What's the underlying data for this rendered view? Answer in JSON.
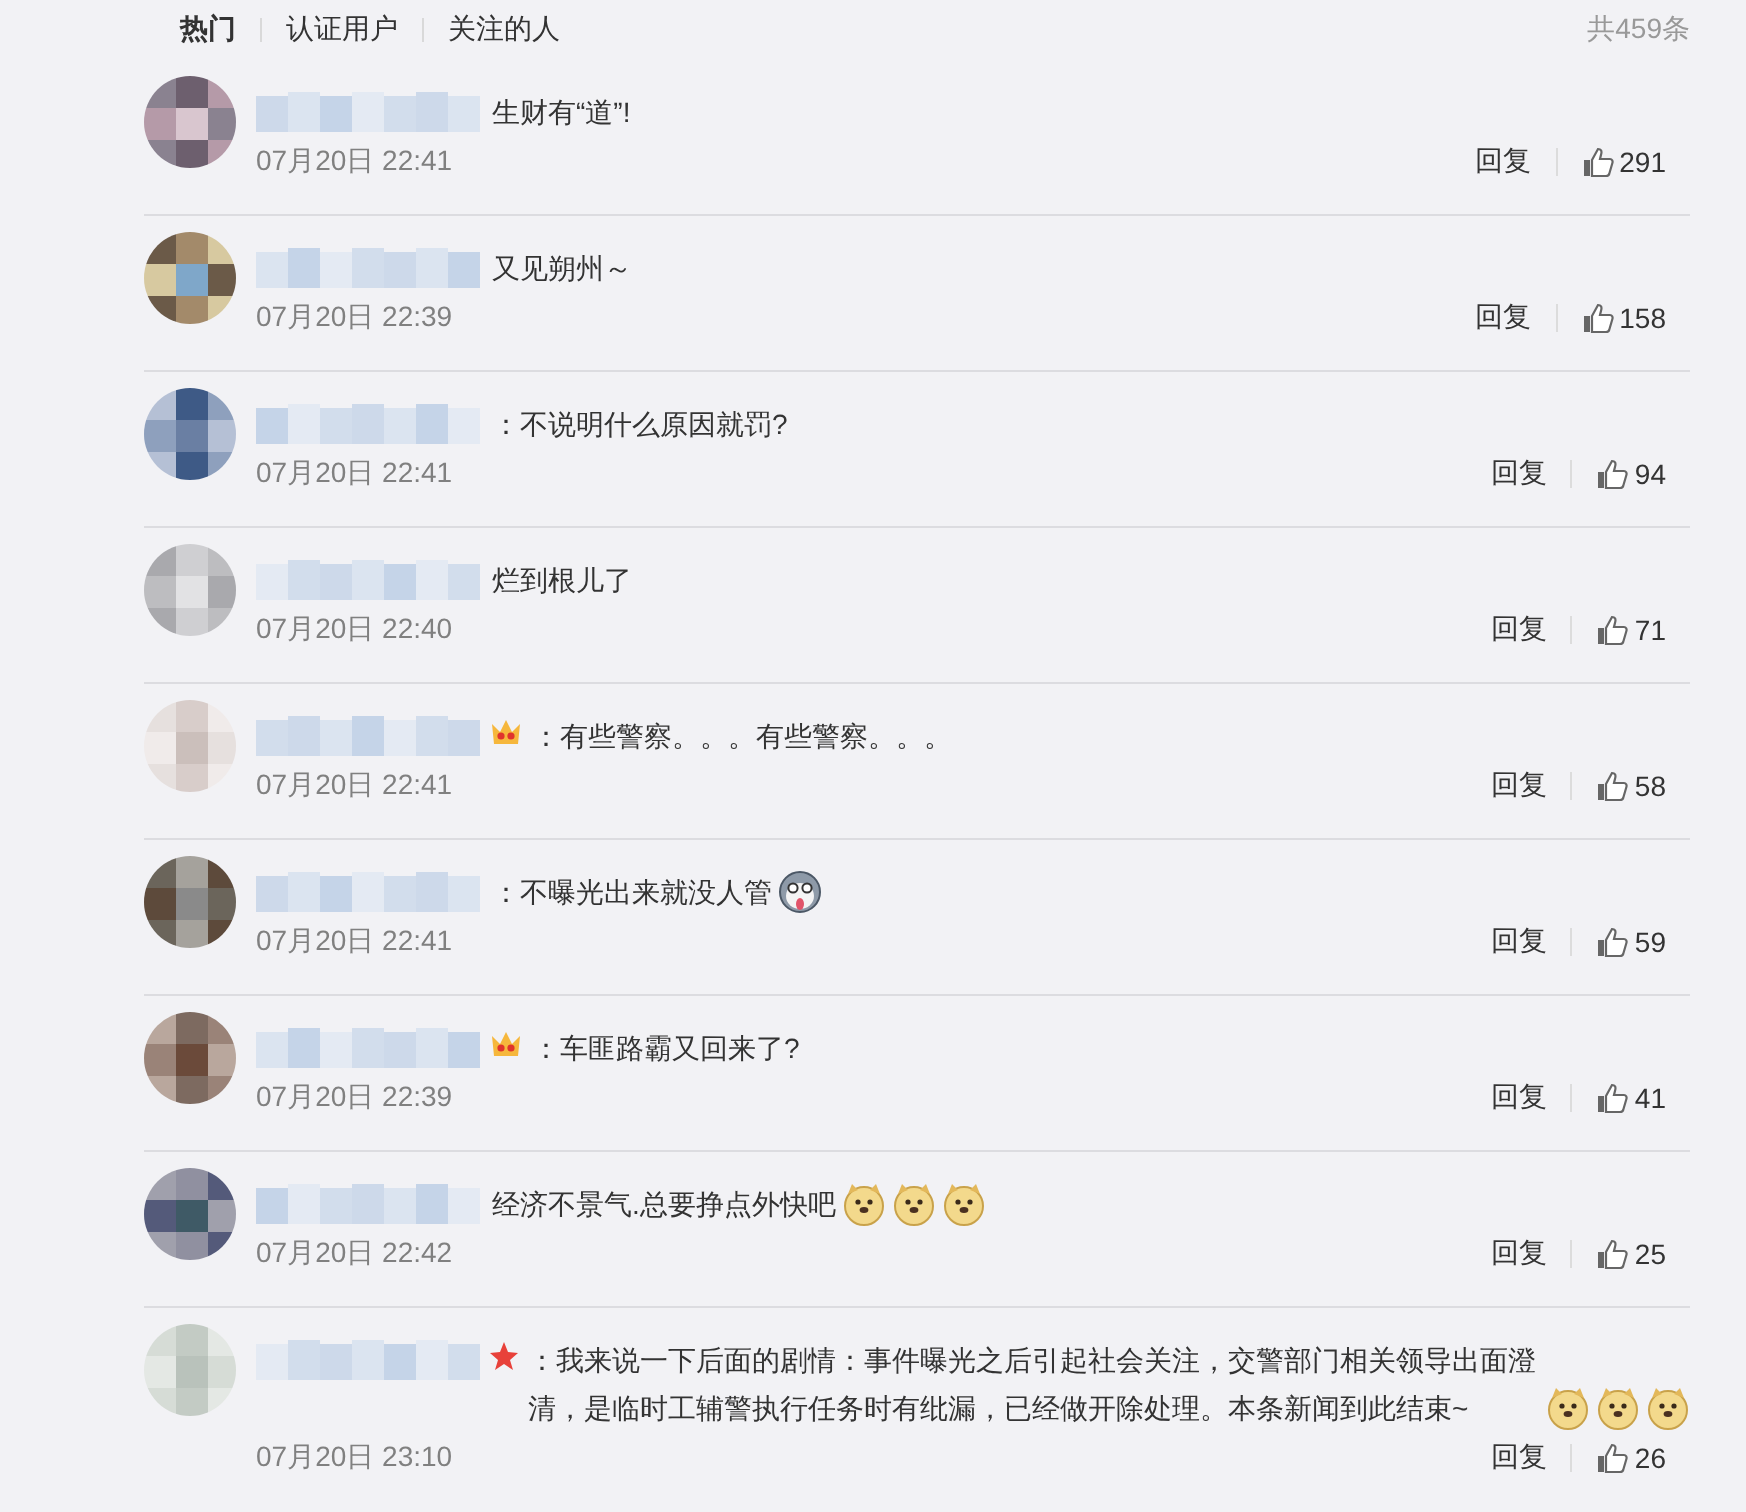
{
  "tabs": [
    {
      "label": "热门",
      "selected": true
    },
    {
      "label": "认证用户",
      "selected": false
    },
    {
      "label": "关注的人",
      "selected": false
    }
  ],
  "total": "共459条",
  "comments": [
    {
      "text": "生财有“道”!",
      "time": "07月20日 22:41",
      "reply": "回复",
      "likes": "291"
    },
    {
      "text": "又见朔州～",
      "time": "07月20日 22:39",
      "reply": "回复",
      "likes": "158"
    },
    {
      "text": "：不说明什么原因就罚?",
      "time": "07月20日 22:41",
      "reply": "回复",
      "likes": "94"
    },
    {
      "text": "烂到根儿了",
      "time": "07月20日 22:40",
      "reply": "回复",
      "likes": "71"
    },
    {
      "badge": {
        "kind": "crown"
      },
      "text": "：有些警察。。。有些警察。。。",
      "time": "07月20日 22:41",
      "reply": "回复",
      "likes": "58"
    },
    {
      "text": "：不曝光出来就没人管",
      "emojis": [
        {
          "kind": "husky"
        }
      ],
      "time": "07月20日 22:41",
      "reply": "回复",
      "likes": "59"
    },
    {
      "badge": {
        "kind": "crown"
      },
      "text": "：车匪路霸又回来了?",
      "time": "07月20日 22:39",
      "reply": "回复",
      "likes": "41"
    },
    {
      "text": "经济不景气.总要挣点外快吧",
      "emojis": [
        {
          "kind": "doge"
        },
        {
          "kind": "doge"
        },
        {
          "kind": "doge"
        }
      ],
      "time": "07月20日 22:42",
      "reply": "回复",
      "likes": "25"
    },
    {
      "badge": {
        "kind": "star"
      },
      "text": "：我来说一下后面的剧情：事件曝光之后引起社会关注，交警部门相关领导出面澄清，是临时工辅警执行任务时有纰漏，已经做开除处理。本条新闻到此结束~",
      "emojis": [
        {
          "kind": "doge"
        },
        {
          "kind": "doge"
        },
        {
          "kind": "doge"
        }
      ],
      "time": "07月20日 23:10",
      "reply": "回复",
      "likes": "26"
    }
  ]
}
